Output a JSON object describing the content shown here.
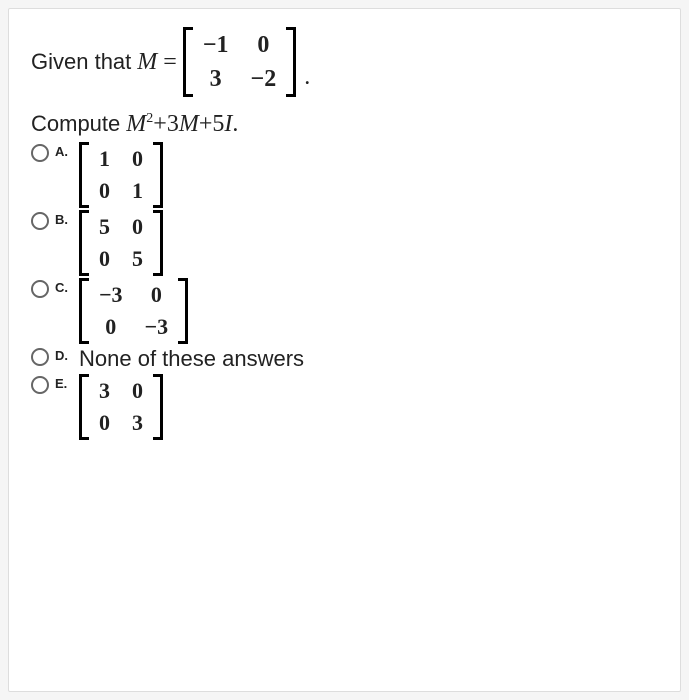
{
  "prompt": {
    "given_text": "Given that",
    "var_name": "M",
    "equals": "=",
    "matrix": [
      [
        "−1",
        "0"
      ],
      [
        "3",
        "−2"
      ]
    ],
    "period": "."
  },
  "compute": {
    "label": "Compute",
    "expr_M": "M",
    "expr_sq": "2",
    "expr_plus1": "+",
    "expr_3": "3",
    "expr_M2": "M",
    "expr_plus2": "+",
    "expr_5": "5",
    "expr_I": "I",
    "expr_dot": "."
  },
  "options": {
    "A": {
      "label": "A.",
      "matrix": [
        [
          "1",
          "0"
        ],
        [
          "0",
          "1"
        ]
      ]
    },
    "B": {
      "label": "B.",
      "matrix": [
        [
          "5",
          "0"
        ],
        [
          "0",
          "5"
        ]
      ]
    },
    "C": {
      "label": "C.",
      "matrix": [
        [
          "−3",
          "0"
        ],
        [
          "0",
          "−3"
        ]
      ]
    },
    "D": {
      "label": "D.",
      "text": "None of these answers"
    },
    "E": {
      "label": "E.",
      "matrix": [
        [
          "3",
          "0"
        ],
        [
          "0",
          "3"
        ]
      ]
    }
  }
}
